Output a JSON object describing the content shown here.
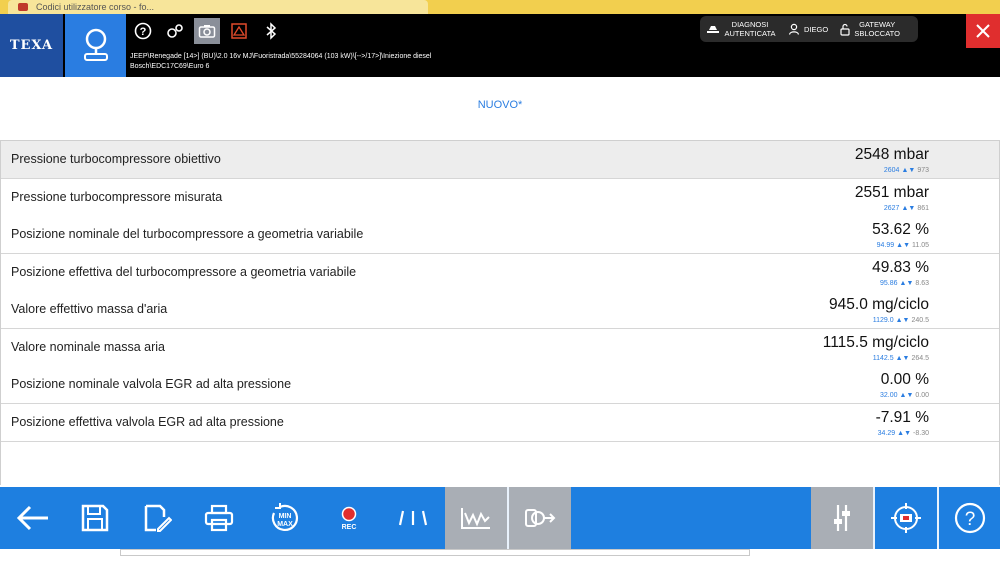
{
  "browser": {
    "tab_title": "Codici utilizzatore corso - fo..."
  },
  "header": {
    "logo": "TEXA",
    "vehicle_path_line1": "JEEP\\Renegade [14>] (BU)\\2.0 16v MJ\\Fuoristrada\\55284064 (103 kW)\\[-->/17>]\\Iniezione diesel",
    "vehicle_path_line2": "Bosch\\EDC17C69\\Euro 6",
    "status": {
      "diagnosis": "DIAGNOSI AUTENTICATA",
      "user": "DIEGO",
      "gateway": "GATEWAY SBLOCCATO"
    }
  },
  "page": {
    "subtitle": "NUOVO*"
  },
  "rows": [
    {
      "label": "Pressione turbocompressore obiettivo",
      "value": "2548 mbar",
      "max": "2604",
      "min": "973",
      "selected": true
    },
    {
      "label": "Pressione turbocompressore misurata",
      "value": "2551 mbar",
      "max": "2627",
      "min": "861"
    },
    {
      "label": "Posizione nominale del turbocompressore a geometria variabile",
      "value": "53.62 %",
      "max": "94.99",
      "min": "11.05"
    },
    {
      "label": "Posizione effettiva del turbocompressore a geometria variabile",
      "value": "49.83 %",
      "max": "95.86",
      "min": "8.63"
    },
    {
      "label": "Valore effettivo massa d'aria",
      "value": "945.0 mg/ciclo",
      "max": "1129.0",
      "min": "240.5"
    },
    {
      "label": "Valore nominale massa aria",
      "value": "1115.5 mg/ciclo",
      "max": "1142.5",
      "min": "264.5"
    },
    {
      "label": "Posizione nominale valvola EGR ad alta pressione",
      "value": "0.00 %",
      "max": "32.00",
      "min": "0.00"
    },
    {
      "label": "Posizione effettiva valvola EGR ad alta pressione",
      "value": "-7.91 %",
      "max": "34.29",
      "min": "-8.30"
    }
  ],
  "arrows": "▲▼",
  "toolbar": {
    "rec_label": "REC",
    "minmax_label_top": "MIN",
    "minmax_label_bottom": "MAX",
    "icons": [
      "back-arrow-icon",
      "save-icon",
      "edit-icon",
      "print-icon",
      "minmax-reset-icon",
      "record-icon",
      "filter-icon",
      "graph-icon",
      "export-icon",
      "adjust-icon",
      "inspect-icon",
      "help-icon"
    ]
  },
  "colors": {
    "accent": "#1e7fe0",
    "topbar": "#000000",
    "close": "#e02e2e",
    "logo_bg": "#1f4fa0"
  }
}
